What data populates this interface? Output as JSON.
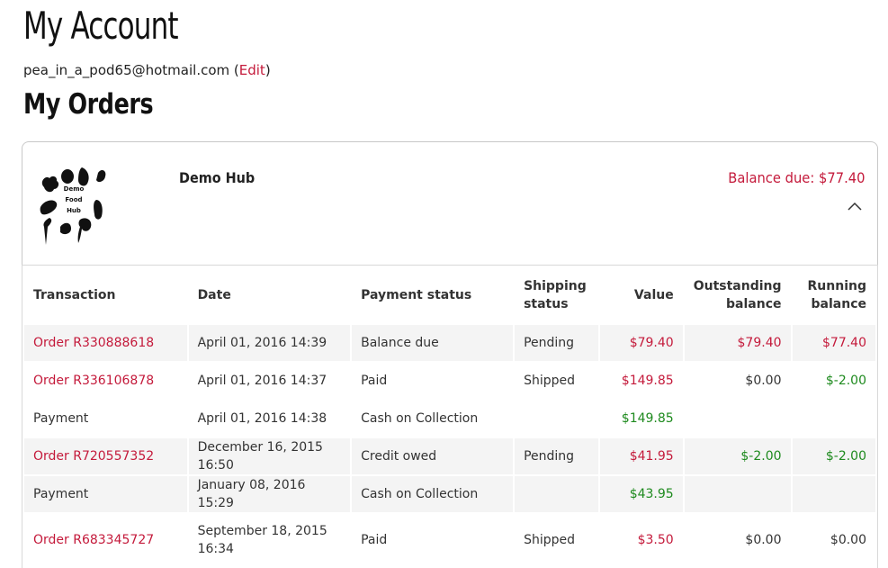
{
  "page": {
    "title": "My Account",
    "email": "pea_in_a_pod65@hotmail.com",
    "edit_label": "Edit",
    "orders_heading": "My Orders"
  },
  "hub": {
    "name": "Demo Hub",
    "balance_due": "Balance due: $77.40",
    "logo_text": [
      "Demo",
      "Food",
      "Hub"
    ]
  },
  "table": {
    "headers": {
      "transaction": "Transaction",
      "date": "Date",
      "payment_status": "Payment status",
      "shipping_status_1": "Shipping",
      "shipping_status_2": "status",
      "value": "Value",
      "outstanding_1": "Outstanding",
      "outstanding_2": "balance",
      "running_1": "Running",
      "running_2": "balance"
    },
    "rows": [
      {
        "transaction": "Order R330888618",
        "date": "April 01, 2016 14:39",
        "payment_status": "Balance due",
        "shipping_status": "Pending",
        "value": "$79.40",
        "outstanding": "$79.40",
        "running": "$77.40"
      },
      {
        "transaction": "Order R336106878",
        "date": "April 01, 2016 14:37",
        "payment_status": "Paid",
        "shipping_status": "Shipped",
        "value": "$149.85",
        "outstanding": "$0.00",
        "running": "$-2.00"
      },
      {
        "transaction": "Payment",
        "date": "April 01, 2016 14:38",
        "payment_status": "Cash on Collection",
        "shipping_status": "",
        "value": "$149.85",
        "outstanding": "",
        "running": ""
      },
      {
        "transaction": "Order R720557352",
        "date": "December 16, 2015 16:50",
        "payment_status": "Credit owed",
        "shipping_status": "Pending",
        "value": "$41.95",
        "outstanding": "$-2.00",
        "running": "$-2.00"
      },
      {
        "transaction": "Payment",
        "date": "January 08, 2016 15:29",
        "payment_status": "Cash on Collection",
        "shipping_status": "",
        "value": "$43.95",
        "outstanding": "",
        "running": ""
      },
      {
        "transaction": "Order R683345727",
        "date_1": "September 18, 2015",
        "date_2": "16:34",
        "payment_status": "Paid",
        "shipping_status": "Shipped",
        "value": "$3.50",
        "outstanding": "$0.00",
        "running": "$0.00"
      }
    ]
  },
  "colors": {
    "accent_red": "#c41a3b",
    "positive_green": "#1e8a1e",
    "row_shade": "#f4f4f4"
  }
}
